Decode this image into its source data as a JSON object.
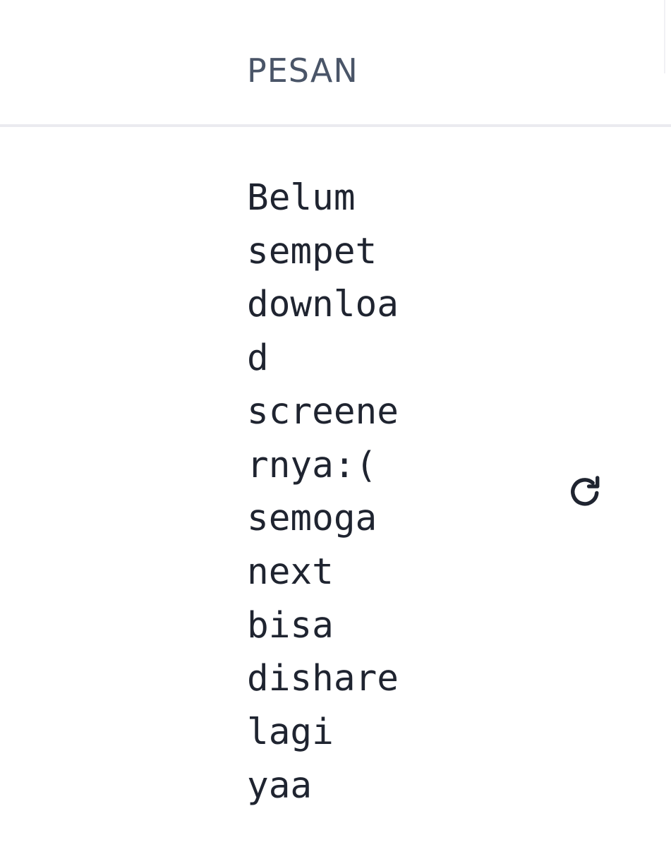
{
  "header": {
    "title": "PESAN"
  },
  "message": {
    "text": "Belum\nsempet\ndownloa\nd\nscreene\nrnya:(\nsemoga\nnext\nbisa\ndishare\nlagi\nyaa"
  },
  "actions": {
    "refresh_icon": "refresh-icon"
  },
  "colors": {
    "title": "#4a5568",
    "text": "#1f2430",
    "divider": "#ebebf0",
    "icon": "#1f2430"
  }
}
